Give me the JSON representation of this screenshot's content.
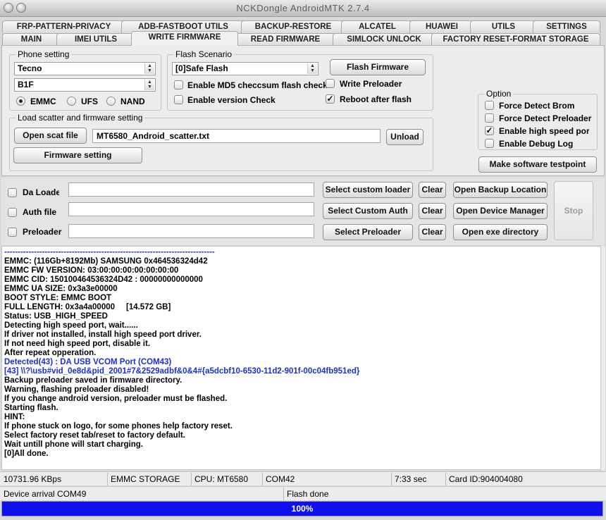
{
  "window": {
    "title": "NCKDongle AndroidMTK 2.7.4"
  },
  "tabs_row1": [
    "FRP-PATTERN-PRIVACY",
    "ADB-FASTBOOT UTILS",
    "BACKUP-RESTORE",
    "ALCATEL",
    "HUAWEI",
    "UTILS",
    "SETTINGS"
  ],
  "tabs_row2": [
    "MAIN",
    "IMEI UTILS",
    "WRITE FIRMWARE",
    "READ FIRMWARE",
    "SIMLOCK UNLOCK",
    "FACTORY RESET-FORMAT STORAGE"
  ],
  "active_tab": "WRITE FIRMWARE",
  "phone_setting": {
    "label": "Phone setting",
    "brand": "Tecno",
    "model": "B1F",
    "storage_options": [
      "EMMC",
      "UFS",
      "NAND"
    ],
    "storage_selected": "EMMC"
  },
  "flash_scenario": {
    "label": "Flash Scenario",
    "selected": "[0]Safe Flash",
    "flash_button": "Flash Firmware",
    "md5_label": "Enable MD5 checcsum flash check",
    "version_label": "Enable version Check",
    "write_preloader_label": "Write Preloader",
    "reboot_label": "Reboot after flash",
    "md5_checked": false,
    "version_checked": false,
    "write_preloader_checked": false,
    "reboot_checked": true
  },
  "scatter": {
    "label": "Load scatter and firmware setting",
    "open_button": "Open scat file",
    "file": "MT6580_Android_scatter.txt",
    "unload_button": "Unload",
    "firmware_setting_button": "Firmware setting"
  },
  "option": {
    "label": "Option",
    "force_brom": "Force Detect Brom",
    "force_preloader": "Force Detect Preloader",
    "high_speed": "Enable high speed port",
    "debug_log": "Enable Debug Log",
    "force_brom_checked": false,
    "force_preloader_checked": false,
    "high_speed_checked": true,
    "debug_log_checked": false,
    "testpoint_button": "Make software testpoint"
  },
  "loaders": {
    "da_label": "Da Loader",
    "auth_label": "Auth file",
    "preloader_label": "Preloader",
    "select_custom_loader": "Select custom loader",
    "select_custom_auth": "Select Custom Auth",
    "select_preloader": "Select Preloader",
    "clear": "Clear",
    "open_backup": "Open Backup Location",
    "open_device_manager": "Open Device Manager",
    "open_exe": "Open exe directory",
    "stop": "Stop"
  },
  "log": {
    "lines": [
      {
        "text": "------------------------------------------------------------------------------",
        "color": "#1a2fd4"
      },
      {
        "text": "EMMC: (116Gb+8192Mb) SAMSUNG 0x464536324d42",
        "color": "#000000"
      },
      {
        "text": "EMMC FW VERSION: 03:00:00:00:00:00:00:00",
        "color": "#000000"
      },
      {
        "text": "EMMC CID: 150100464536324D42 : 00000000000000",
        "color": "#000000"
      },
      {
        "text": "EMMC UA SIZE: 0x3a3e00000",
        "color": "#000000"
      },
      {
        "text": "BOOT STYLE: EMMC BOOT",
        "color": "#000000"
      },
      {
        "text": "FULL LENGTH: 0x3a4a00000     [14.572 GB]",
        "color": "#000000"
      },
      {
        "text": "Status: USB_HIGH_SPEED",
        "color": "#000000"
      },
      {
        "text": "Detecting high speed port, wait......",
        "color": "#000000"
      },
      {
        "text": "If driver not installed, install high speed port driver.",
        "color": "#000000"
      },
      {
        "text": "If not need high speed port, disable it.",
        "color": "#000000"
      },
      {
        "text": "After repeat opperation.",
        "color": "#000000"
      },
      {
        "text": "Detected(43) : DA USB VCOM Port (COM43)",
        "color": "#1a2fd4"
      },
      {
        "text": "[43] \\\\?\\usb#vid_0e8d&pid_2001#7&2529adbf&0&4#{a5dcbf10-6530-11d2-901f-00c04fb951ed}",
        "color": "#1a2fd4"
      },
      {
        "text": "Backup preloader saved in firmware directory.",
        "color": "#000000"
      },
      {
        "text": "Warning, flashing preloader disabled!",
        "color": "#000000"
      },
      {
        "text": "If you change android version, preloader must be flashed.",
        "color": "#000000"
      },
      {
        "text": "Starting flash.",
        "color": "#000000"
      },
      {
        "text": "HINT:",
        "color": "#000000"
      },
      {
        "text": "If phone stuck on logo, for some phones help factory reset.",
        "color": "#000000"
      },
      {
        "text": "Select factory reset tab/reset to factory default.",
        "color": "#000000"
      },
      {
        "text": "Wait untill phone will start charging.",
        "color": "#000000"
      },
      {
        "text": "[0]All done.",
        "color": "#000000"
      }
    ]
  },
  "statusbar": {
    "speed": "10731.96 KBps",
    "storage": "EMMC STORAGE",
    "cpu": "CPU: MT6580",
    "port": "COM42",
    "time": "7:33 sec",
    "card_id": "Card ID:904004080",
    "device": "Device arrival COM49",
    "message": "Flash done"
  },
  "progress": {
    "value": 1.0,
    "label": "100%",
    "color": "#1010ee"
  }
}
